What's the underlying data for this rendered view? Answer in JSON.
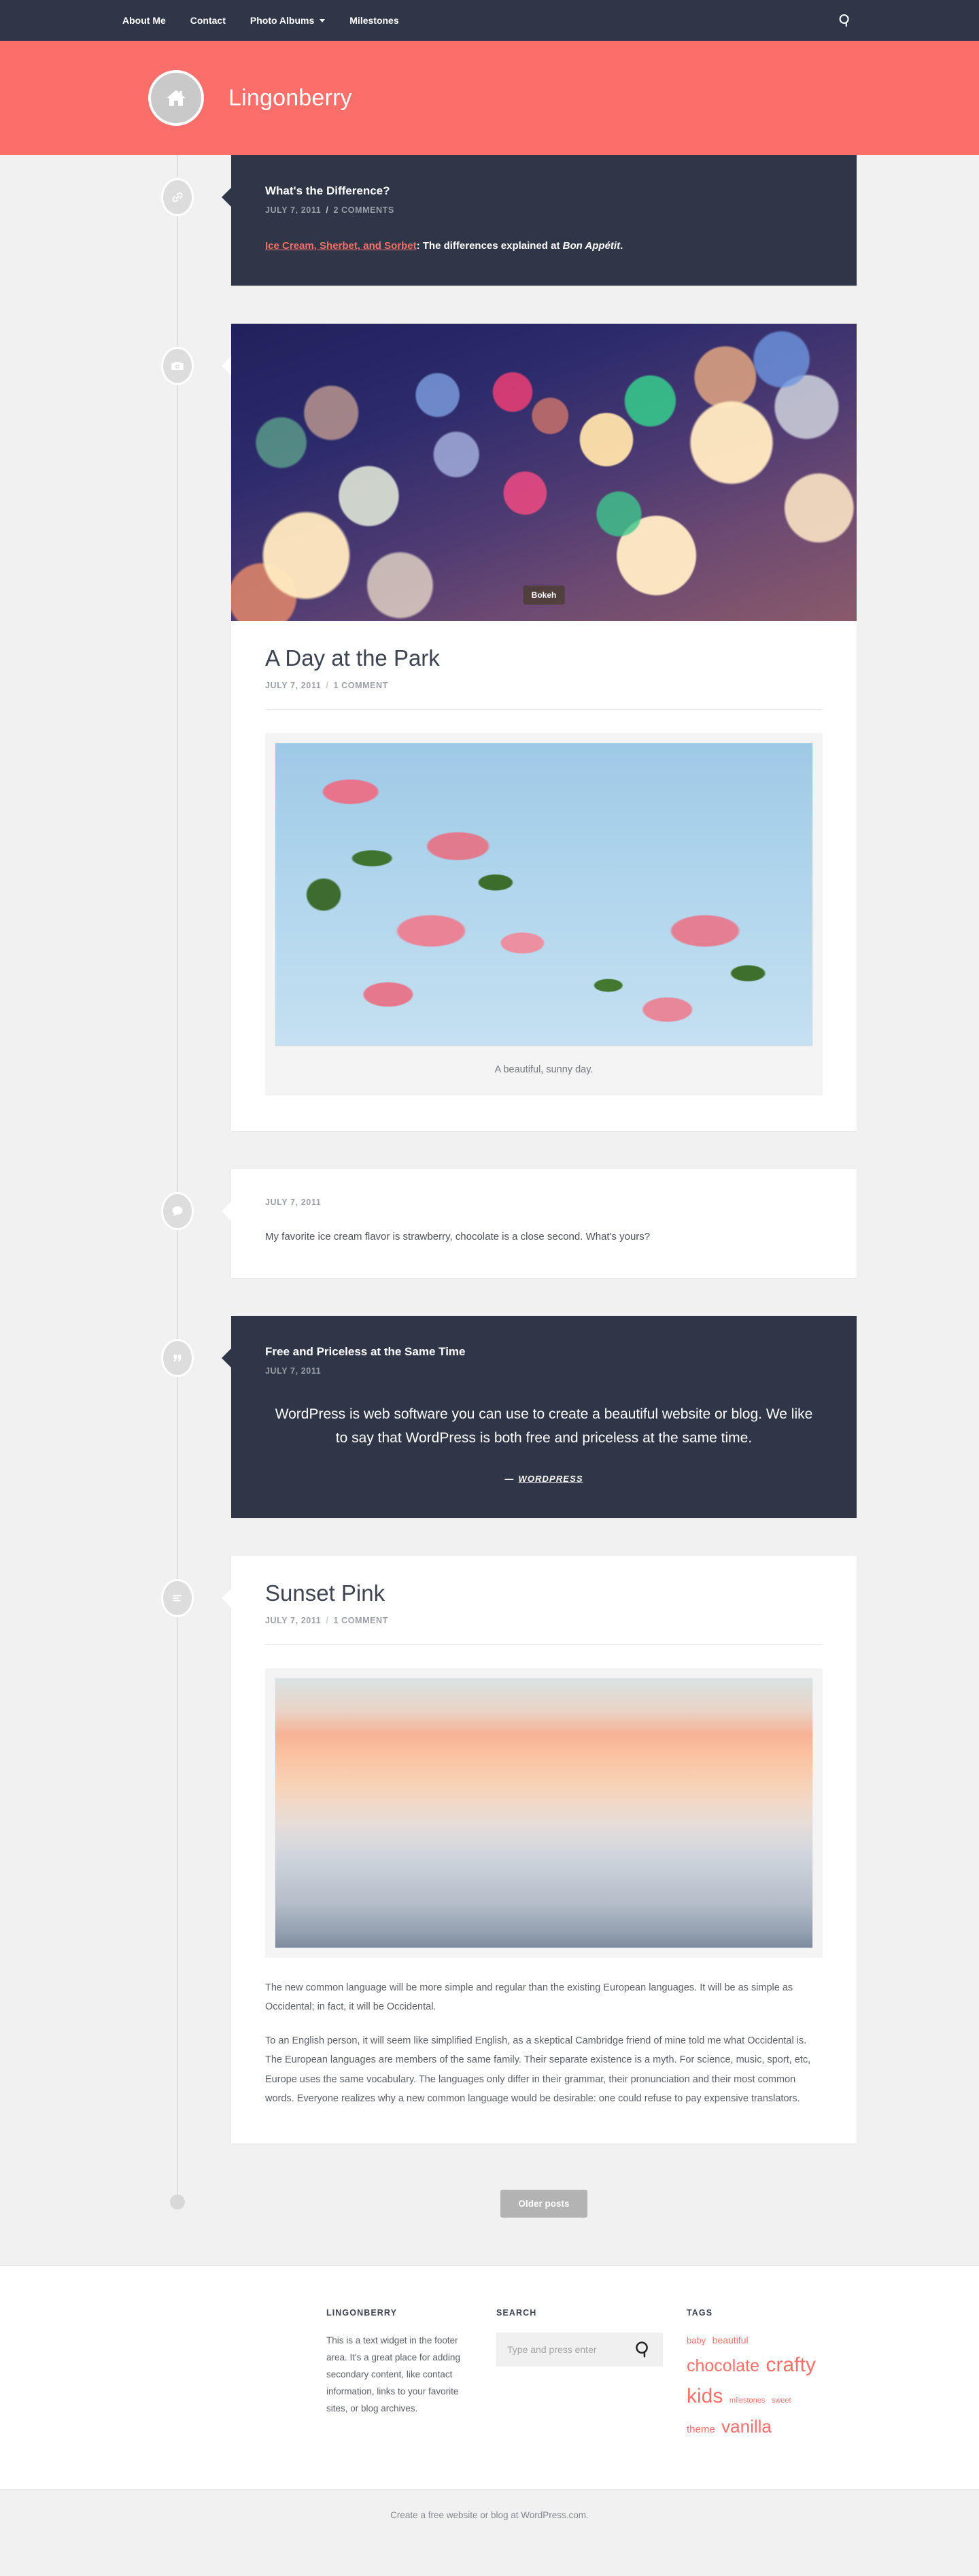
{
  "nav": {
    "items": [
      {
        "label": "About Me",
        "has_dropdown": false
      },
      {
        "label": "Contact",
        "has_dropdown": false
      },
      {
        "label": "Photo Albums",
        "has_dropdown": true
      },
      {
        "label": "Milestones",
        "has_dropdown": false
      }
    ],
    "search_icon": "search-icon"
  },
  "header": {
    "site_title": "Lingonberry",
    "logo_icon": "home-icon",
    "accent_color": "#fc6e6a",
    "dark_color": "#2f3647"
  },
  "entries": [
    {
      "format": "link",
      "icon": "link-icon",
      "title": "What's the Difference?",
      "date": "JULY 7, 2011",
      "separator": "/",
      "comments": "2 COMMENTS",
      "link_text": "Ice Cream, Sherbet, and Sorbet",
      "body_after": ": The differences explained at ",
      "body_em": "Bon Appétit",
      "body_end": "."
    },
    {
      "format": "image",
      "icon": "camera-icon",
      "hero_caption": "Bokeh",
      "title": "A Day at the Park",
      "date": "JULY 7, 2011",
      "separator": "/",
      "comments": "1 COMMENT",
      "figure_caption": "A beautiful, sunny day."
    },
    {
      "format": "status",
      "icon": "chat-bubble-icon",
      "date": "JULY 7, 2011",
      "body": "My favorite ice cream flavor is strawberry, chocolate is a close second. What's yours?"
    },
    {
      "format": "quote",
      "icon": "quote-icon",
      "title": "Free and Priceless at the Same Time",
      "date": "JULY 7, 2011",
      "quote": "WordPress is web software you can use to create a beautiful website or blog. We like to say that WordPress is both free and priceless at the same time.",
      "cite_dash": "—",
      "cite": "WORDPRESS"
    },
    {
      "format": "standard",
      "icon": "aside-lines-icon",
      "title": "Sunset Pink",
      "date": "JULY 7, 2011",
      "separator": "/",
      "comments": "1 COMMENT",
      "paragraphs": [
        "The new common language will be more simple and regular than the existing European languages. It will be as simple as Occidental; in fact, it will be Occidental.",
        "To an English person, it will seem like simplified English, as a skeptical Cambridge friend of mine told me what Occidental is. The European languages are members of the same family. Their separate existence is a myth. For science, music, sport, etc, Europe uses the same vocabulary. The languages only differ in their grammar, their pronunciation and their most common words. Everyone realizes why a new common language would be desirable: one could refuse to pay expensive translators."
      ]
    }
  ],
  "pager": {
    "older_posts_label": "Older posts"
  },
  "footer": {
    "widgets": {
      "text": {
        "title": "LINGONBERRY",
        "body": "This is a text widget in the footer area. It's a great place for adding secondary content, like contact information, links to your favorite sites, or blog archives."
      },
      "search": {
        "title": "SEARCH",
        "placeholder": "Type and press enter",
        "value": "",
        "icon": "search-icon"
      },
      "tags": {
        "title": "TAGS",
        "color": "#fc6e6a",
        "items": [
          {
            "label": "baby",
            "size": 13
          },
          {
            "label": "beautiful",
            "size": 14
          },
          {
            "label": "chocolate",
            "size": 25
          },
          {
            "label": "crafty",
            "size": 30
          },
          {
            "label": "kids",
            "size": 30
          },
          {
            "label": "milestones",
            "size": 11
          },
          {
            "label": "sweet",
            "size": 11
          },
          {
            "label": "theme",
            "size": 15
          },
          {
            "label": "vanilla",
            "size": 26
          }
        ]
      }
    },
    "credit": "Create a free website or blog at WordPress.com."
  }
}
